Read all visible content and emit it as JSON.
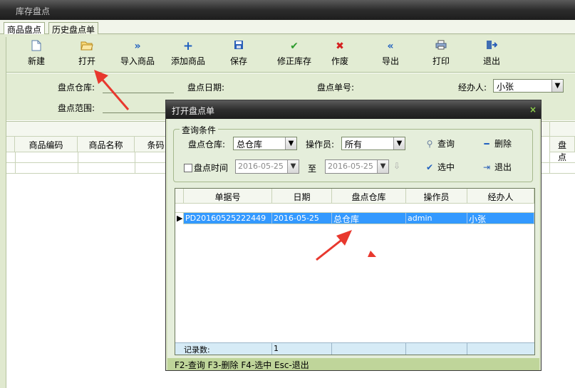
{
  "window": {
    "title": "库存盘点"
  },
  "tabs": [
    {
      "label": "商品盘点",
      "active": true
    },
    {
      "label": "历史盘点单",
      "active": false
    }
  ],
  "toolbar": {
    "buttons": [
      {
        "label": "新建",
        "icon": "new-doc-icon"
      },
      {
        "label": "打开",
        "icon": "open-folder-icon"
      },
      {
        "label": "导入商品",
        "icon": "double-chevron-right-icon"
      },
      {
        "label": "添加商品",
        "icon": "plus-icon"
      },
      {
        "label": "保存",
        "icon": "save-icon"
      },
      {
        "label": "修正库存",
        "icon": "checkmark-icon"
      },
      {
        "label": "作废",
        "icon": "x-icon"
      },
      {
        "label": "导出",
        "icon": "double-chevron-left-icon"
      },
      {
        "label": "打印",
        "icon": "printer-icon"
      },
      {
        "label": "退出",
        "icon": "exit-icon"
      }
    ]
  },
  "form": {
    "warehouse_label": "盘点仓库:",
    "date_label": "盘点日期:",
    "order_no_label": "盘点单号:",
    "handler_label": "经办人:",
    "handler_value": "小张",
    "range_label": "盘点范围:"
  },
  "back_grid": {
    "headers": [
      "商品编码",
      "商品名称",
      "条码"
    ],
    "right_header": "盘点"
  },
  "dialog": {
    "title": "打开盘点单",
    "close": "×",
    "legend": "查询条件",
    "warehouse_label": "盘点仓库:",
    "warehouse_value": "总仓库",
    "operator_label": "操作员:",
    "operator_value": "所有",
    "query_button": "查询",
    "delete_button": "删除",
    "date_checkbox_label": "盘点时间",
    "date_from": "2016-05-25",
    "date_to_label": "至",
    "date_to": "2016-05-25",
    "select_button": "选中",
    "exit_button": "退出",
    "columns": [
      "单据号",
      "日期",
      "盘点仓库",
      "操作员",
      "经办人"
    ],
    "rows": [
      {
        "order_no": "PD20160525222449",
        "date": "2016-05-25",
        "warehouse": "总仓库",
        "operator": "admin",
        "handler": "小张"
      }
    ],
    "footer_label": "记录数:",
    "footer_count": "1",
    "status_bar": "F2-查询 F3-删除 F4-选中 Esc-退出"
  },
  "colors": {
    "accent_green": "#e2ecd3",
    "selection_blue": "#3399ff",
    "annotation_red": "#e8382e"
  }
}
